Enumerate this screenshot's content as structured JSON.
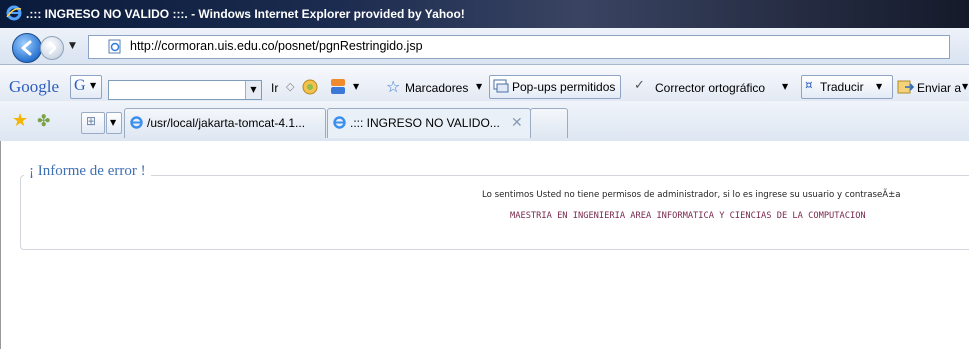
{
  "window": {
    "title": ".::: INGRESO NO VALIDO :::. - Windows Internet Explorer provided by Yahoo!"
  },
  "address_bar": {
    "url": "http://cormoran.uis.edu.co/posnet/pgnRestringido.jsp"
  },
  "google_toolbar": {
    "logo": "Google",
    "go_label": "Ir",
    "bookmarks_label": "Marcadores",
    "popups_label": "Pop-ups permitidos",
    "spellcheck_label": "Corrector ortográfico",
    "translate_label": "Traducir",
    "send_label": "Enviar a"
  },
  "tabs": [
    {
      "label": "/usr/local/jakarta-tomcat-4.1...",
      "active": false
    },
    {
      "label": ".::: INGRESO NO VALIDO...",
      "active": true
    }
  ],
  "page": {
    "legend": "¡ Informe de error !",
    "message": "Lo sentimos Usted no tiene permisos de administrador, si lo es ingrese su usuario y contraseÃ±a",
    "program": "MAESTRIA EN INGENIERIA AREA INFORMATICA Y CIENCIAS DE LA COMPUTACION"
  },
  "colors": {
    "legend": "#3f6fb3",
    "program_text": "#7a2a4e",
    "titlebar": "#0a1a3a"
  }
}
